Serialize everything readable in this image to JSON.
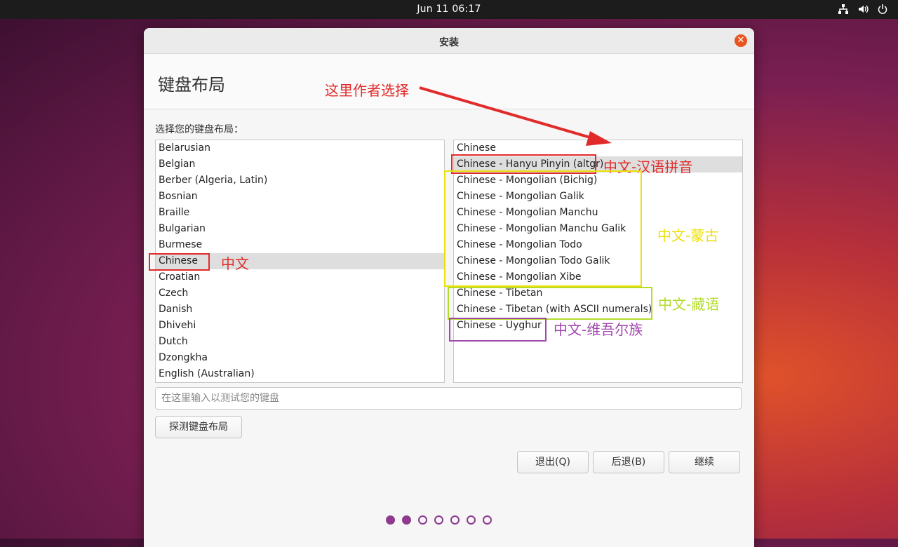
{
  "topbar": {
    "clock": "Jun 11  06:17"
  },
  "window": {
    "title": "安装",
    "page_title": "键盘布局",
    "prompt": "选择您的键盘布局：",
    "layouts": [
      "Belarusian",
      "Belgian",
      "Berber (Algeria, Latin)",
      "Bosnian",
      "Braille",
      "Bulgarian",
      "Burmese",
      "Chinese",
      "Croatian",
      "Czech",
      "Danish",
      "Dhivehi",
      "Dutch",
      "Dzongkha",
      "English (Australian)"
    ],
    "selected_layout": "Chinese",
    "variants": [
      "Chinese",
      "Chinese - Hanyu Pinyin (altgr)",
      "Chinese - Mongolian (Bichig)",
      "Chinese - Mongolian Galik",
      "Chinese - Mongolian Manchu",
      "Chinese - Mongolian Manchu Galik",
      "Chinese - Mongolian Todo",
      "Chinese - Mongolian Todo Galik",
      "Chinese - Mongolian Xibe",
      "Chinese - Tibetan",
      "Chinese - Tibetan (with ASCII numerals)",
      "Chinese - Uyghur"
    ],
    "selected_variant": "Chinese - Hanyu Pinyin (altgr)",
    "test_input": {
      "placeholder": "在这里输入以测试您的键盘",
      "value": ""
    },
    "buttons": {
      "detect": "探测键盘布局",
      "quit": "退出(Q)",
      "back": "后退(B)",
      "continue": "继续"
    },
    "progress": {
      "total_steps": 7,
      "current_step": 2
    }
  },
  "annotations": {
    "author_choice": "这里作者选择",
    "chinese": "中文",
    "pinyin": "中文-汉语拼音",
    "mongolian": "中文-蒙古",
    "tibetan": "中文-藏语",
    "uyghur": "中文-维吾尔族"
  },
  "colors": {
    "accent": "#e95420",
    "progress_dot": "#8e3a8f",
    "annotation_red": "#e12b2b",
    "annotation_yellow": "#ece00b",
    "annotation_lime": "#b3dc2a",
    "annotation_purple": "#a247b0"
  }
}
